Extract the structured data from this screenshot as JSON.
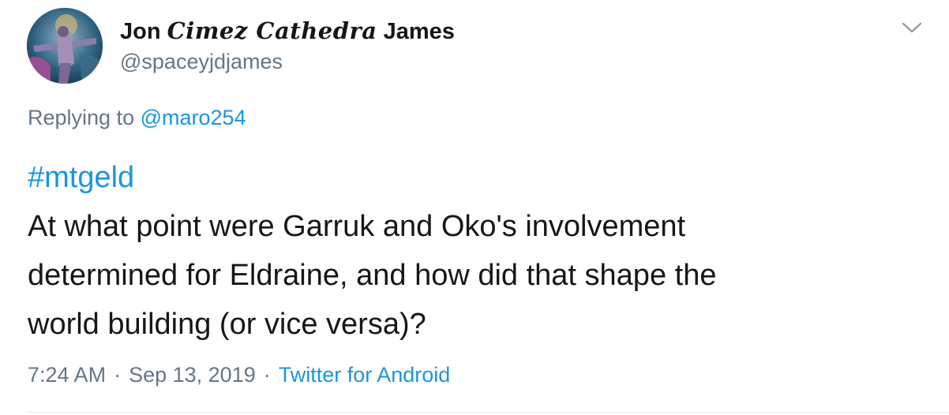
{
  "user": {
    "name_first": "Jon",
    "name_middle": "Cimez Cathedra",
    "name_last": "James",
    "handle": "@spaceyjdjames"
  },
  "reply": {
    "prefix": "Replying to",
    "to_handle": "@maro254"
  },
  "tweet": {
    "hashtag": "#mtgeld",
    "lines": [
      "At what point were Garruk and Oko's involvement",
      "determined for Eldraine, and how did that shape the",
      "world building (or vice versa)?"
    ]
  },
  "meta": {
    "time": "7:24 AM",
    "separator": "·",
    "date": "Sep 13, 2019",
    "source": "Twitter for Android"
  },
  "icons": {
    "caret": "chevron-down-icon"
  },
  "colors": {
    "link": "#1b95e0",
    "secondary_text": "#657786",
    "primary_text": "#14171a"
  }
}
